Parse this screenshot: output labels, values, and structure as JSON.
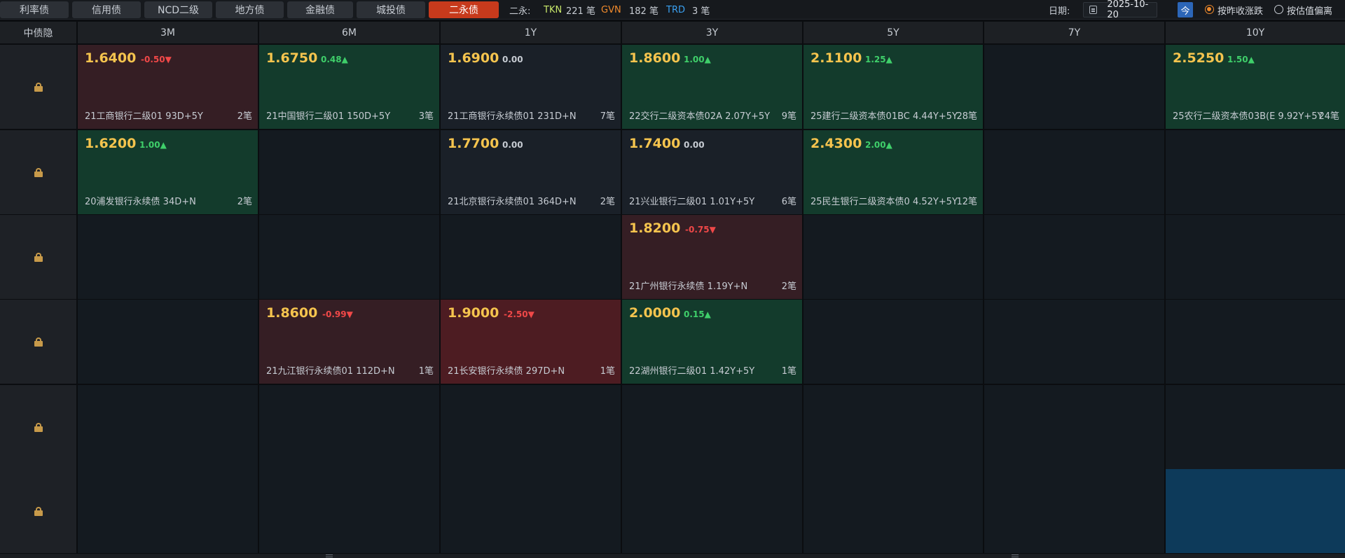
{
  "tabs": [
    {
      "label": "利率债",
      "active": false
    },
    {
      "label": "信用债",
      "active": false
    },
    {
      "label": "NCD二级",
      "active": false
    },
    {
      "label": "地方债",
      "active": false
    },
    {
      "label": "金融债",
      "active": false
    },
    {
      "label": "城投债",
      "active": false
    },
    {
      "label": "二永债",
      "active": true
    }
  ],
  "stats": {
    "prefix": "二永:",
    "tkn_label": "TKN",
    "tkn_count": "221 笔",
    "gvn_label": "GVN",
    "gvn_count": "182 笔",
    "trd_label": "TRD",
    "trd_count": "3 笔"
  },
  "toolbar": {
    "date_label": "日期:",
    "date_value": "2025-10-20",
    "today_label": "今",
    "radio_prev_close": "按昨收涨跌",
    "radio_valuation": "按估值偏离",
    "selected_mode": "按昨收涨跌"
  },
  "colors": {
    "up": "#3fcf6a",
    "down": "#f04848",
    "price": "#f5c44e",
    "active_tab": "#c73a1c",
    "tkn": "#c8e86a",
    "gvn": "#f08a2c",
    "trd": "#3aa0f0"
  },
  "grid": {
    "corner_label": "中债隐",
    "columns": [
      "3M",
      "6M",
      "1Y",
      "3Y",
      "5Y",
      "7Y",
      "10Y"
    ],
    "row_icon": "lock-icon",
    "rows": [
      [
        {
          "tone": "red",
          "price": "1.6400",
          "change": "-0.50",
          "dir": "down",
          "bond": "21工商银行二级01 93D+5Y",
          "count": "2笔"
        },
        {
          "tone": "green",
          "price": "1.6750",
          "change": "0.48",
          "dir": "up",
          "bond": "21中国银行二级01 150D+5Y",
          "count": "3笔"
        },
        {
          "tone": "neutral",
          "price": "1.6900",
          "change": "0.00",
          "dir": "flat",
          "bond": "21工商银行永续债01 231D+N",
          "count": "7笔"
        },
        {
          "tone": "green",
          "price": "1.8600",
          "change": "1.00",
          "dir": "up",
          "bond": "22交行二级资本债02A 2.07Y+5Y",
          "count": "9笔"
        },
        {
          "tone": "green",
          "price": "2.1100",
          "change": "1.25",
          "dir": "up",
          "bond": "25建行二级资本债01BC 4.44Y+5Y",
          "count": "28笔"
        },
        null,
        {
          "tone": "green",
          "price": "2.5250",
          "change": "1.50",
          "dir": "up",
          "bond": "25农行二级资本债03B(E 9.92Y+5Y",
          "count": "24笔"
        }
      ],
      [
        {
          "tone": "green",
          "price": "1.6200",
          "change": "1.00",
          "dir": "up",
          "bond": "20浦发银行永续债 34D+N",
          "count": "2笔"
        },
        null,
        {
          "tone": "neutral",
          "price": "1.7700",
          "change": "0.00",
          "dir": "flat",
          "bond": "21北京银行永续债01 364D+N",
          "count": "2笔"
        },
        {
          "tone": "neutral",
          "price": "1.7400",
          "change": "0.00",
          "dir": "flat",
          "bond": "21兴业银行二级01 1.01Y+5Y",
          "count": "6笔"
        },
        {
          "tone": "green",
          "price": "2.4300",
          "change": "2.00",
          "dir": "up",
          "bond": "25民生银行二级资本债0 4.52Y+5Y",
          "count": "12笔"
        },
        null,
        null
      ],
      [
        null,
        null,
        null,
        {
          "tone": "red",
          "price": "1.8200",
          "change": "-0.75",
          "dir": "down",
          "bond": "21广州银行永续债 1.19Y+N",
          "count": "2笔"
        },
        null,
        null,
        null
      ],
      [
        null,
        {
          "tone": "red",
          "price": "1.8600",
          "change": "-0.99",
          "dir": "down",
          "bond": "21九江银行永续债01 112D+N",
          "count": "1笔"
        },
        {
          "tone": "red-strong",
          "price": "1.9000",
          "change": "-2.50",
          "dir": "down",
          "bond": "21长安银行永续债 297D+N",
          "count": "1笔"
        },
        {
          "tone": "green",
          "price": "2.0000",
          "change": "0.15",
          "dir": "up",
          "bond": "22湖州银行二级01 1.42Y+5Y",
          "count": "1笔"
        },
        null,
        null,
        null
      ],
      [
        null,
        null,
        null,
        null,
        null,
        null,
        null
      ],
      [
        null,
        null,
        null,
        null,
        null,
        null,
        {
          "tone": "blue"
        }
      ]
    ]
  }
}
